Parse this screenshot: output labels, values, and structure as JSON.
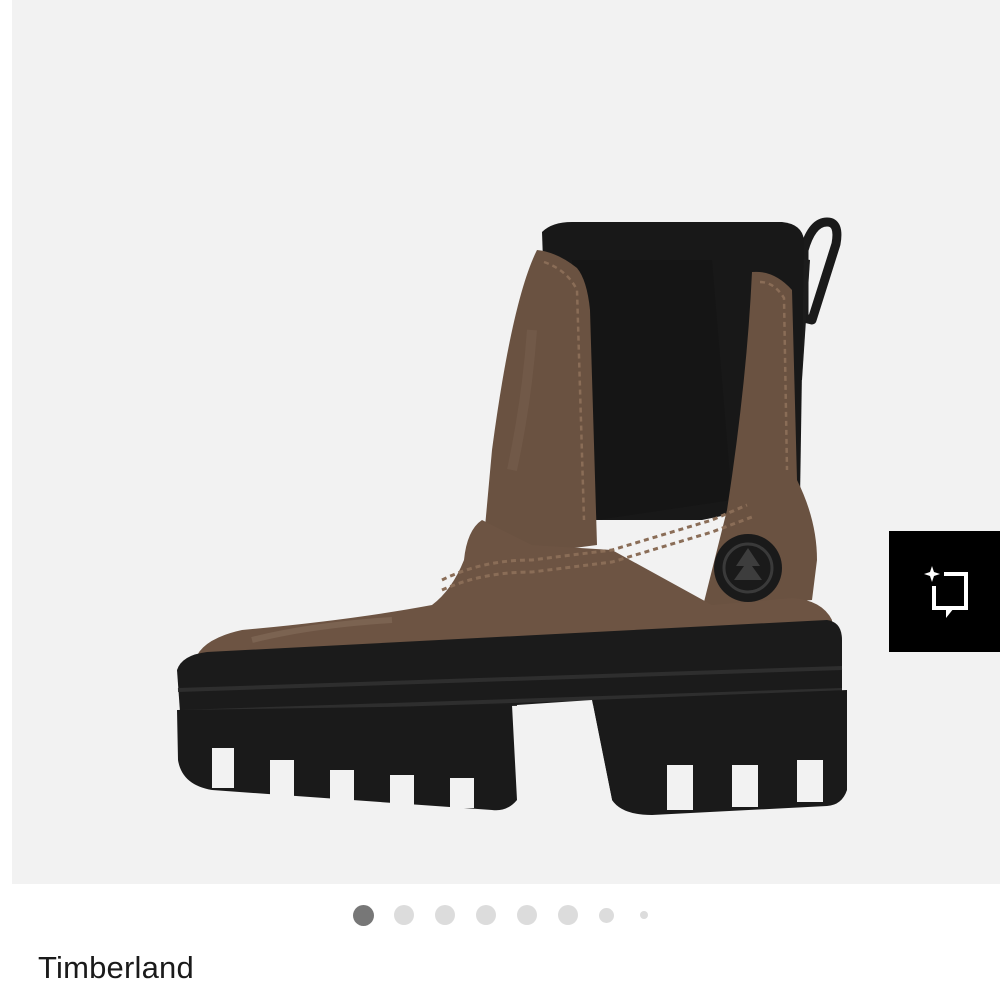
{
  "product": {
    "brand": "Timberland",
    "image_description_icon": "chelsea-boot-image"
  },
  "gallery": {
    "background_color": "#f2f2f2",
    "total_images": 8,
    "active_index": 0
  },
  "ai_button": {
    "icon": "sparkle-crop-icon",
    "background_color": "#000000"
  },
  "colors": {
    "dot_active": "#777777",
    "dot_inactive": "#dcdcdc",
    "text": "#1a1a1a"
  }
}
